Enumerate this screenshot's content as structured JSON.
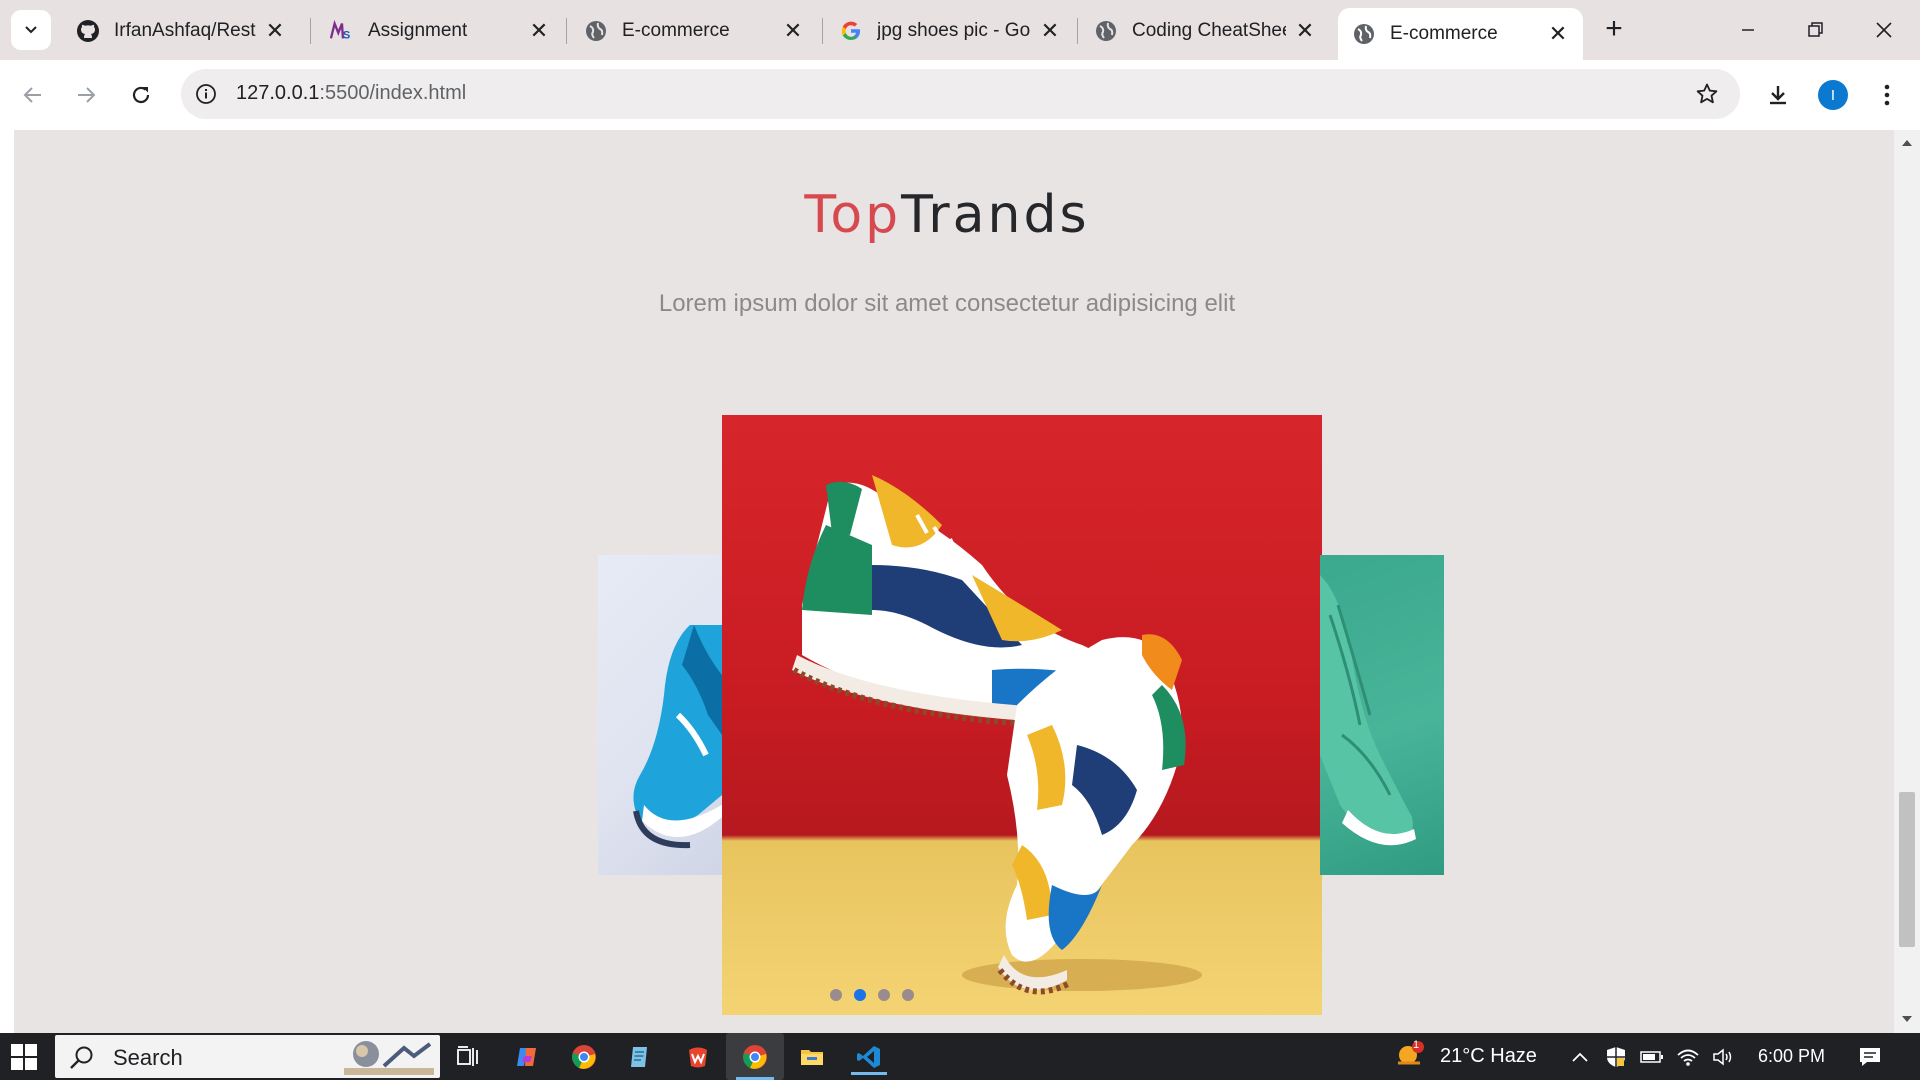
{
  "browser": {
    "tabs": [
      {
        "label": "IrfanAshfaq/Resturant",
        "icon": "github-icon",
        "active": false
      },
      {
        "label": "Assignment",
        "icon": "lms-icon",
        "active": false
      },
      {
        "label": "E-commerce",
        "icon": "globe-icon",
        "active": false
      },
      {
        "label": "jpg shoes pic - Google Search",
        "icon": "google-icon",
        "active": false
      },
      {
        "label": "Coding CheatSheet",
        "icon": "globe-icon",
        "active": false
      },
      {
        "label": "E-commerce",
        "icon": "globe-icon",
        "active": true
      }
    ],
    "new_tab_label": "+",
    "close_glyph": "✕",
    "address": {
      "host": "127.0.0.1",
      "rest": ":5500/index.html"
    },
    "profile_initial": "I"
  },
  "page": {
    "title_part1": "Top",
    "title_part2": "Trands",
    "subtitle": "Lorem ipsum dolor sit amet consectetur adipisicing elit",
    "carousel": {
      "slide_count": 4,
      "active_index": 1,
      "slides": [
        "blue-sneaker-image",
        "colorful-sneakers-red-background-image",
        "teal-sneaker-image"
      ]
    }
  },
  "taskbar": {
    "search_placeholder": "Search",
    "weather": "21°C  Haze",
    "time": "6:00 PM",
    "weather_badge": "1"
  },
  "colors": {
    "title_accent": "#d64a4f",
    "title_dark": "#25272b",
    "dot_active": "#1a73e8",
    "page_bg": "#e8e4e4"
  }
}
